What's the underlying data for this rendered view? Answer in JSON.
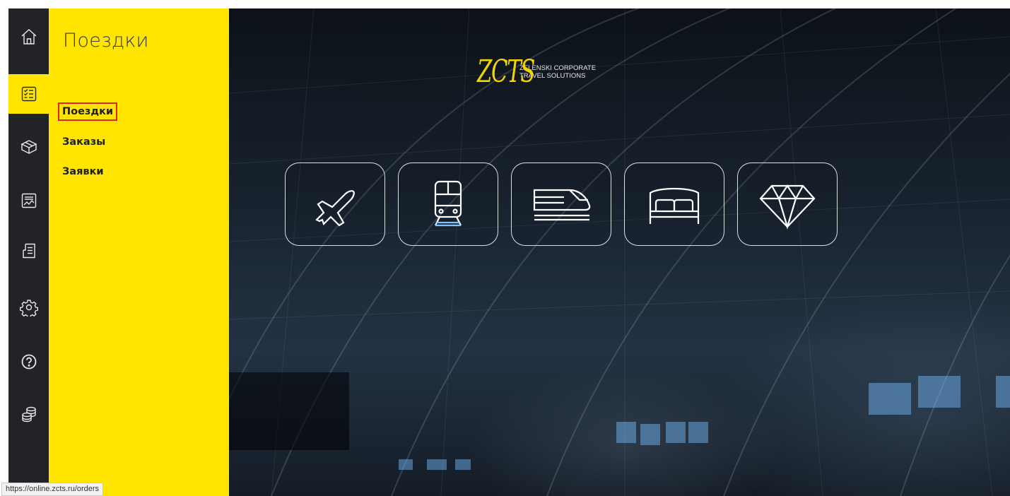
{
  "sidebar": {
    "items": [
      {
        "icon": "home-icon",
        "active": false
      },
      {
        "icon": "checklist-icon",
        "active": true
      },
      {
        "icon": "box-icon",
        "active": false
      },
      {
        "icon": "report-chart-icon",
        "active": false
      },
      {
        "icon": "document-list-icon",
        "active": false
      },
      {
        "icon": "gear-icon",
        "active": false
      },
      {
        "icon": "help-icon",
        "active": false
      },
      {
        "icon": "coins-icon",
        "active": false
      }
    ]
  },
  "panel": {
    "title": "Поездки",
    "links": [
      "Поездки",
      "Заказы",
      "Заявки"
    ]
  },
  "logo": {
    "mark": "ZCTS",
    "line1": "ZELENSKI CORPORATE",
    "line2": "TRAVEL SOLUTIONS"
  },
  "services": [
    "airplane-icon",
    "train-icon",
    "highspeed-train-icon",
    "hotel-bed-icon",
    "diamond-icon"
  ],
  "status": {
    "url": "https://online.zcts.ru/orders"
  },
  "colors": {
    "accent": "#ffe500",
    "rail": "#222326",
    "highlight": "#e1251b"
  }
}
